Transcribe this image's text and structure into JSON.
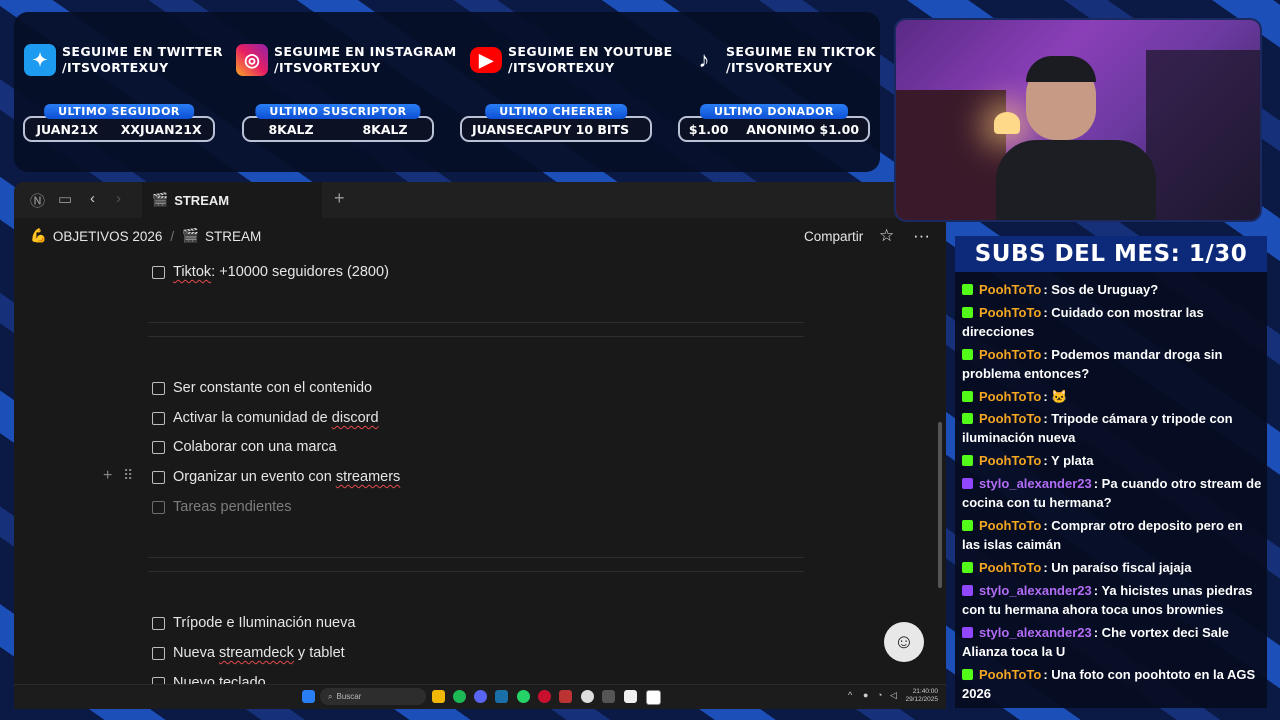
{
  "overlay": {
    "socials": [
      {
        "icon": "twitter-icon",
        "line1": "SEGUIME EN TWITTER",
        "line2": "/ITSVORTEXUY"
      },
      {
        "icon": "instagram-icon",
        "line1": "SEGUIME EN INSTAGRAM",
        "line2": "/ITSVORTEXUY"
      },
      {
        "icon": "youtube-icon",
        "line1": "SEGUIME EN YOUTUBE",
        "line2": "/ITSVORTEXUY"
      },
      {
        "icon": "tiktok-icon",
        "line1": "SEGUIME EN TIKTOK",
        "line2": "/ITSVORTEXUY"
      }
    ],
    "stats": [
      {
        "label": "ULTIMO SEGUIDOR",
        "v1": "JUAN21X",
        "v2": "XXJUAN21X"
      },
      {
        "label": "ULTIMO SUSCRIPTOR",
        "v1": "8KALZ",
        "v2": "8KALZ"
      },
      {
        "label": "ULTIMO CHEERER",
        "v1": "JUANSECAPUY 10 BITS",
        "v2": ""
      },
      {
        "label": "ULTIMO DONADOR",
        "v1": "$1.00",
        "v2": "ANONIMO $1.00"
      }
    ]
  },
  "notion": {
    "tab_title": "STREAM",
    "breadcrumb": [
      "OBJETIVOS 2026",
      "STREAM"
    ],
    "share_label": "Compartir",
    "tasks_group1": [
      "Tiktok: +10000 seguidores (2800)"
    ],
    "tasks_group2": [
      "Ser constante con el contenido",
      "Activar la comunidad de discord",
      "Colaborar con una marca",
      "Organizar un evento con streamers"
    ],
    "placeholder": "Tareas pendientes",
    "tasks_group3": [
      "Trípode e Iluminación nueva",
      "Nueva streamdeck y tablet",
      "Nuevo teclado"
    ]
  },
  "taskbar": {
    "search_placeholder": "Buscar",
    "time": "21:40:00",
    "date": "29/12/2025"
  },
  "chat": {
    "header": "SUBS DEL MES: 1/30",
    "messages": [
      {
        "badge": "kick",
        "user": "PoohToTo",
        "text": ": Sos de Uruguay?"
      },
      {
        "badge": "kick",
        "user": "PoohToTo",
        "text": ": Cuidado con mostrar las direcciones"
      },
      {
        "badge": "kick",
        "user": "PoohToTo",
        "text": ": Podemos mandar droga sin problema entonces?"
      },
      {
        "badge": "kick",
        "user": "PoohToTo",
        "text": ": 🐱"
      },
      {
        "badge": "kick",
        "user": "PoohToTo",
        "text": ": Tripode cámara y tripode con iluminación nueva"
      },
      {
        "badge": "kick",
        "user": "PoohToTo",
        "text": ": Y plata"
      },
      {
        "badge": "twitch",
        "user": "stylo_alexander23",
        "text": ": Pa cuando otro stream de cocina con tu hermana?"
      },
      {
        "badge": "kick",
        "user": "PoohToTo",
        "text": ": Comprar otro deposito pero en las islas caimán"
      },
      {
        "badge": "kick",
        "user": "PoohToTo",
        "text": ": Un paraíso fiscal jajaja"
      },
      {
        "badge": "twitch",
        "user": "stylo_alexander23",
        "text": ": Ya hicistes unas piedras con tu hermana ahora toca unos brownies"
      },
      {
        "badge": "twitch",
        "user": "stylo_alexander23",
        "text": ": Che vortex deci Sale Alianza toca la U"
      },
      {
        "badge": "kick",
        "user": "PoohToTo",
        "text": ": Una foto con poohtoto en la AGS 2026"
      }
    ]
  },
  "colors": {
    "kick_user": "#f5a623",
    "twitch_user": "#b36cf5",
    "kick_badge": "#53fc18",
    "twitch_badge": "#9146ff"
  }
}
